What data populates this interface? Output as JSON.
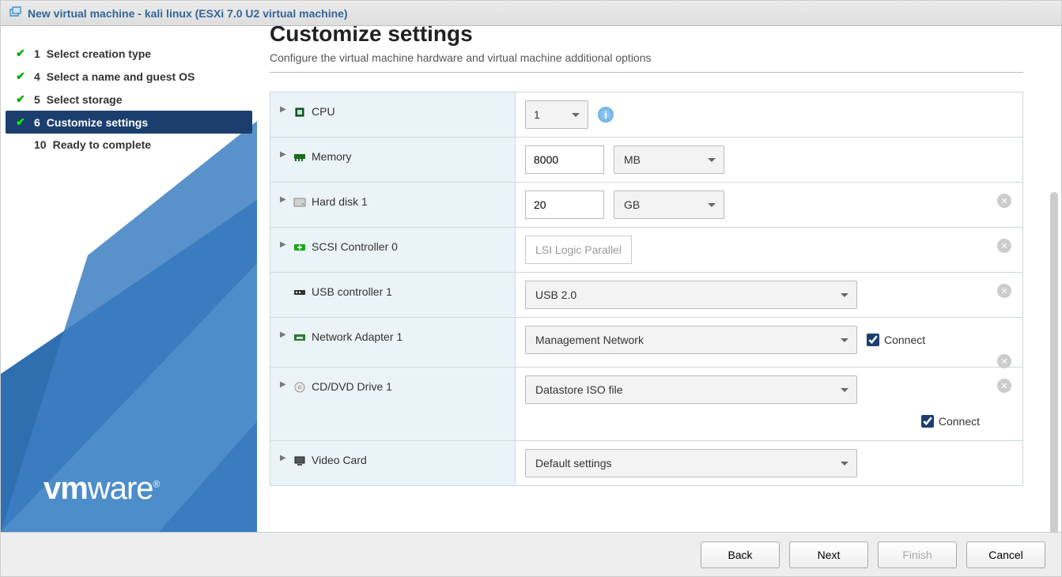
{
  "window": {
    "title": "New virtual machine - kali linux (ESXi 7.0 U2 virtual machine)"
  },
  "wizard_steps": [
    {
      "num": "1",
      "label": "Select creation type",
      "done": true
    },
    {
      "num": "4",
      "label": "Select a name and guest OS",
      "done": true
    },
    {
      "num": "5",
      "label": "Select storage",
      "done": true
    },
    {
      "num": "6",
      "label": "Customize settings",
      "done": true,
      "active": true
    },
    {
      "num": "10",
      "label": "Ready to complete",
      "done": false
    }
  ],
  "page": {
    "heading": "Customize settings",
    "subtitle": "Configure the virtual machine hardware and virtual machine additional options"
  },
  "hw": {
    "cpu": {
      "label": "CPU",
      "value": "1"
    },
    "memory": {
      "label": "Memory",
      "value": "8000",
      "unit": "MB"
    },
    "disk": {
      "label": "Hard disk 1",
      "value": "20",
      "unit": "GB"
    },
    "scsi": {
      "label": "SCSI Controller 0",
      "value": "LSI Logic Parallel"
    },
    "usb": {
      "label": "USB controller 1",
      "value": "USB 2.0"
    },
    "nic": {
      "label": "Network Adapter 1",
      "value": "Management Network",
      "connect_label": "Connect"
    },
    "cddvd": {
      "label": "CD/DVD Drive 1",
      "value": "Datastore ISO file",
      "connect_label": "Connect"
    },
    "video": {
      "label": "Video Card",
      "value": "Default settings"
    }
  },
  "footer": {
    "back": "Back",
    "next": "Next",
    "finish": "Finish",
    "cancel": "Cancel"
  },
  "brand": {
    "vm": "vm",
    "ware": "ware"
  }
}
